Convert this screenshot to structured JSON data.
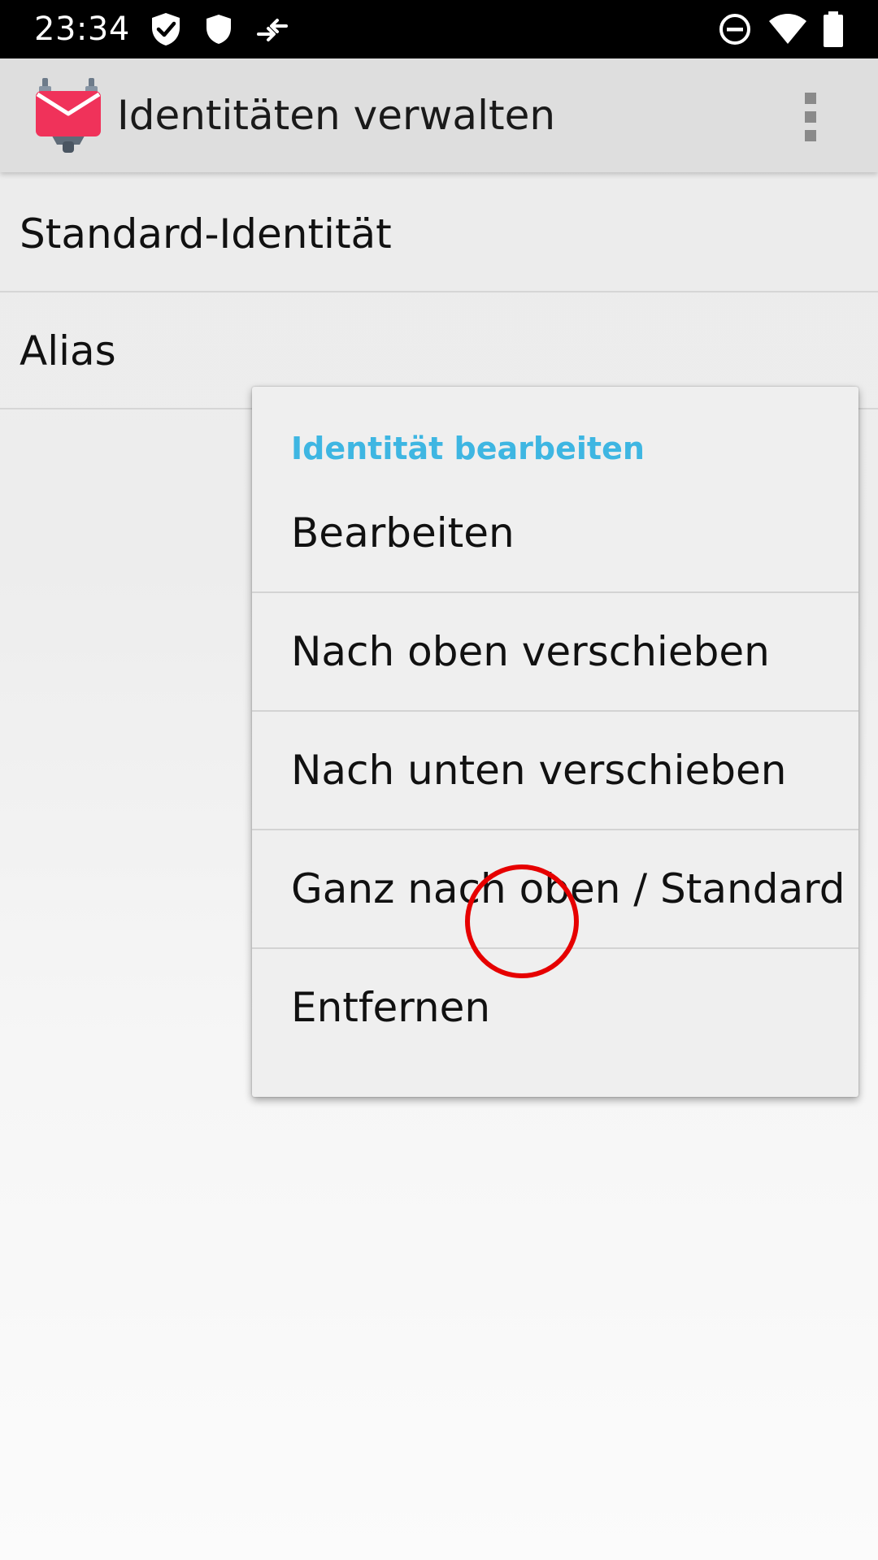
{
  "status_bar": {
    "time": "23:34",
    "icons_left": [
      "shield-check-icon",
      "shield-icon",
      "data-transfer-icon"
    ],
    "icons_right": [
      "do-not-disturb-icon",
      "wifi-icon",
      "battery-icon"
    ]
  },
  "app_bar": {
    "title": "Identitäten verwalten",
    "logo": "k9-mail-logo",
    "overflow_icon": "more-vert-icon"
  },
  "identities": [
    {
      "label": "Standard-Identität"
    },
    {
      "label": "Alias"
    }
  ],
  "context_menu": {
    "title": "Identität bearbeiten",
    "items": [
      {
        "label": "Bearbeiten"
      },
      {
        "label": "Nach oben verschieben"
      },
      {
        "label": "Nach unten verschieben"
      },
      {
        "label": "Ganz nach oben / Standard"
      },
      {
        "label": "Entfernen"
      }
    ]
  },
  "colors": {
    "status_bar": "#000000",
    "app_bar": "#dedede",
    "dialog_title": "#3eb6e2",
    "tap_indicator": "#e60000",
    "logo_envelope": "#f0325a"
  }
}
